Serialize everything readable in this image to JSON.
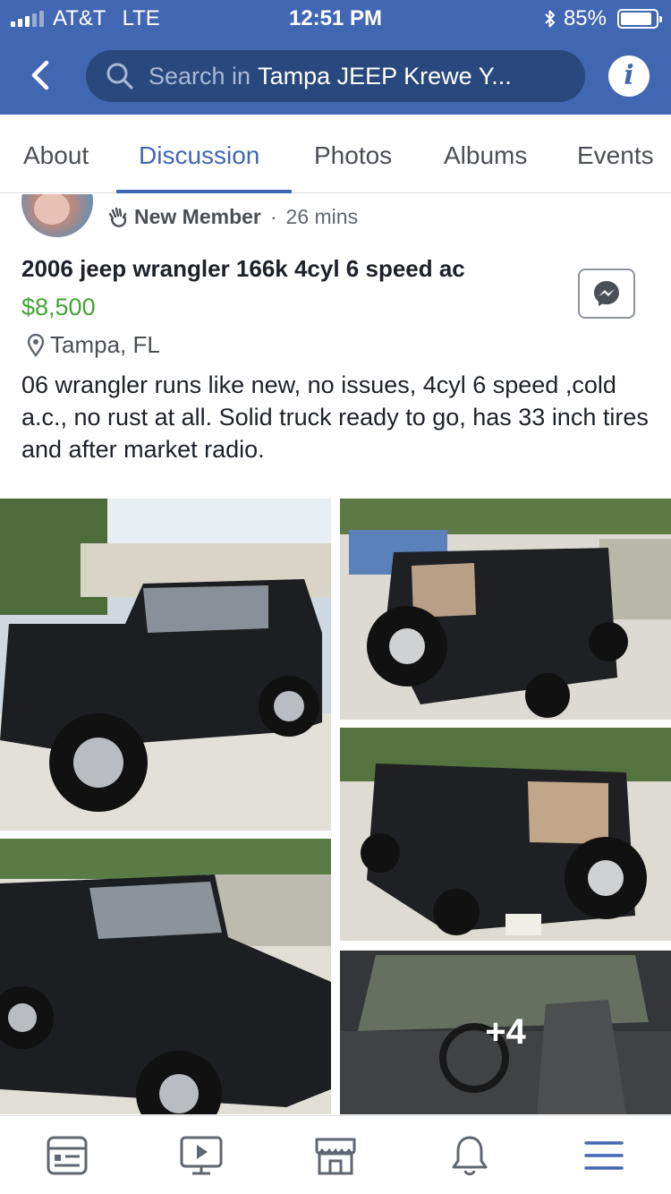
{
  "status_bar": {
    "carrier": "AT&T",
    "network": "LTE",
    "time": "12:51 PM",
    "battery": "85%"
  },
  "header": {
    "search_prefix": "Search in",
    "group_name": "Tampa JEEP Krewe Y...",
    "info_icon": "i"
  },
  "tabs": [
    {
      "label": "About"
    },
    {
      "label": "Discussion",
      "active": true
    },
    {
      "label": "Photos"
    },
    {
      "label": "Albums"
    },
    {
      "label": "Events"
    }
  ],
  "post": {
    "author_badge": "New Member",
    "separator": "·",
    "time_ago": "26 mins",
    "title": "2006 jeep wrangler 166k 4cyl 6 speed ac",
    "price": "$8,500",
    "location": "Tampa, FL",
    "description": "06 wrangler runs like new, no issues, 4cyl 6 speed ,cold a.c., no rust at all. Solid truck ready to go, has 33 inch tires and after market radio.",
    "more_photos_label": "+4"
  },
  "bottom_nav": [
    {
      "icon": "news-feed-icon"
    },
    {
      "icon": "video-icon"
    },
    {
      "icon": "marketplace-icon"
    },
    {
      "icon": "notifications-bell-icon"
    },
    {
      "icon": "menu-icon",
      "active": true
    }
  ],
  "colors": {
    "brand_blue": "#4267b2",
    "search_bg": "#29487d",
    "price_green": "#42a635"
  }
}
